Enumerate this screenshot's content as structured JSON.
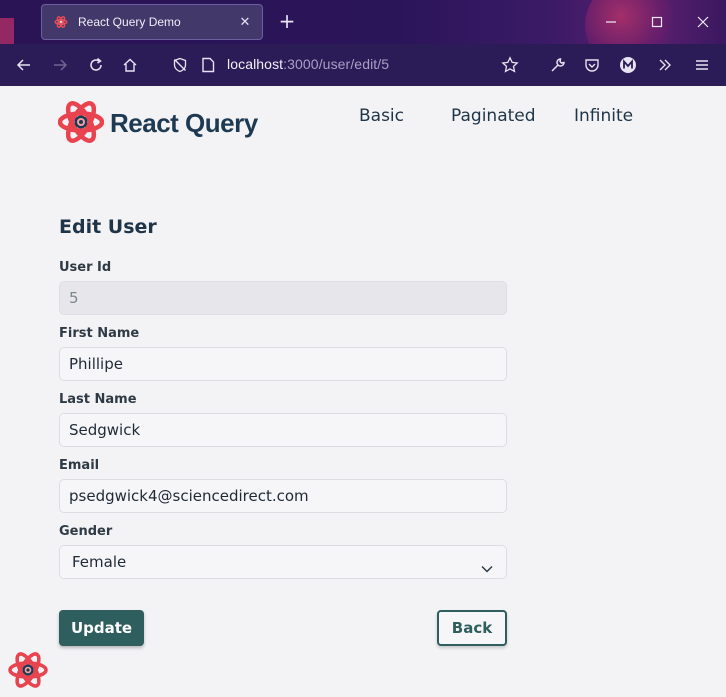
{
  "browser": {
    "tab_title": "React Query Demo",
    "url_host": "localhost",
    "url_rest": ":3000/user/edit/5"
  },
  "header": {
    "logo_text": "React Query",
    "nav": [
      "Basic",
      "Paginated",
      "Infinite"
    ]
  },
  "form": {
    "title": "Edit User",
    "fields": [
      {
        "label": "User Id",
        "value": "5"
      },
      {
        "label": "First Name",
        "value": "Phillipe"
      },
      {
        "label": "Last Name",
        "value": "Sedgwick"
      },
      {
        "label": "Email",
        "value": "psedgwick4@sciencedirect.com"
      },
      {
        "label": "Gender",
        "value": "Female"
      }
    ],
    "update_label": "Update",
    "back_label": "Back"
  },
  "colors": {
    "primary": "#2e5e5d",
    "text": "#1f3447",
    "browser_chrome": "#2b1b56",
    "logo_red": "#e8434e"
  }
}
